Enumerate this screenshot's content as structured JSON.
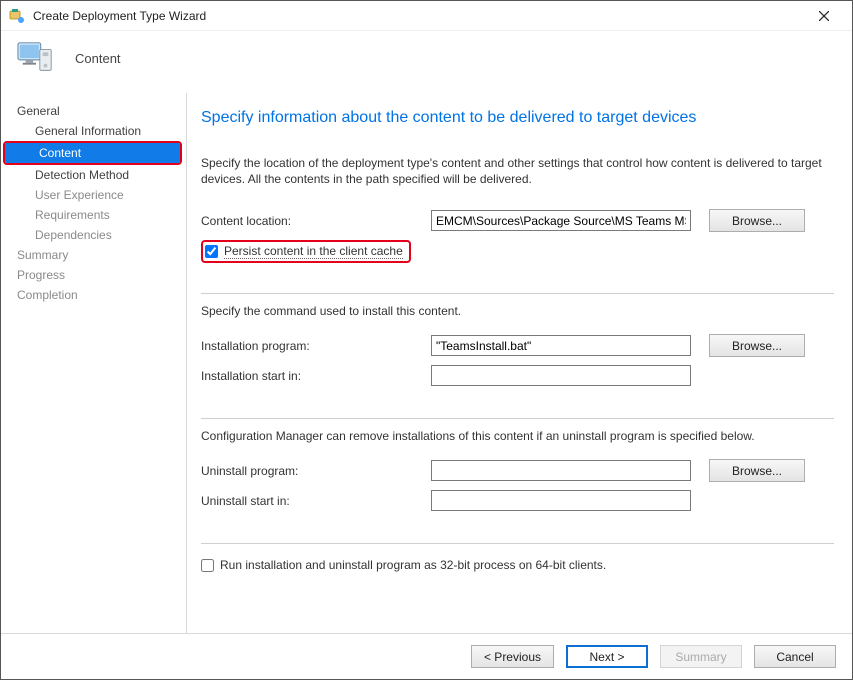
{
  "window": {
    "title": "Create Deployment Type Wizard",
    "page_label": "Content"
  },
  "sidebar": {
    "items": [
      {
        "label": "General",
        "indent": 0,
        "active": false,
        "disabled": false
      },
      {
        "label": "General Information",
        "indent": 1,
        "active": false,
        "disabled": false
      },
      {
        "label": "Content",
        "indent": 1,
        "active": true,
        "disabled": false
      },
      {
        "label": "Detection Method",
        "indent": 1,
        "active": false,
        "disabled": false
      },
      {
        "label": "User Experience",
        "indent": 1,
        "active": false,
        "disabled": true
      },
      {
        "label": "Requirements",
        "indent": 1,
        "active": false,
        "disabled": true
      },
      {
        "label": "Dependencies",
        "indent": 1,
        "active": false,
        "disabled": true
      },
      {
        "label": "Summary",
        "indent": 0,
        "active": false,
        "disabled": true
      },
      {
        "label": "Progress",
        "indent": 0,
        "active": false,
        "disabled": true
      },
      {
        "label": "Completion",
        "indent": 0,
        "active": false,
        "disabled": true
      }
    ]
  },
  "main": {
    "heading": "Specify information about the content to be delivered to target devices",
    "intro": "Specify the location of the deployment type's content and other settings that control how content is delivered to target devices. All the contents in the path specified will be delivered.",
    "content_location_label": "Content location:",
    "content_location_value": "EMCM\\Sources\\Package Source\\MS Teams MSI",
    "browse_label": "Browse...",
    "persist_label": "Persist content in the client cache",
    "persist_checked": true,
    "install_section": "Specify the command used to install this content.",
    "install_program_label": "Installation program:",
    "install_program_value": "\"TeamsInstall.bat\"",
    "install_startin_label": "Installation start in:",
    "install_startin_value": "",
    "uninstall_section": "Configuration Manager can remove installations of this content if an uninstall program is specified below.",
    "uninstall_program_label": "Uninstall program:",
    "uninstall_program_value": "",
    "uninstall_startin_label": "Uninstall start in:",
    "uninstall_startin_value": "",
    "run32_label": "Run installation and uninstall program as 32-bit process on 64-bit clients.",
    "run32_checked": false
  },
  "footer": {
    "previous": "<  Previous",
    "next": "Next  >",
    "summary": "Summary",
    "cancel": "Cancel"
  }
}
